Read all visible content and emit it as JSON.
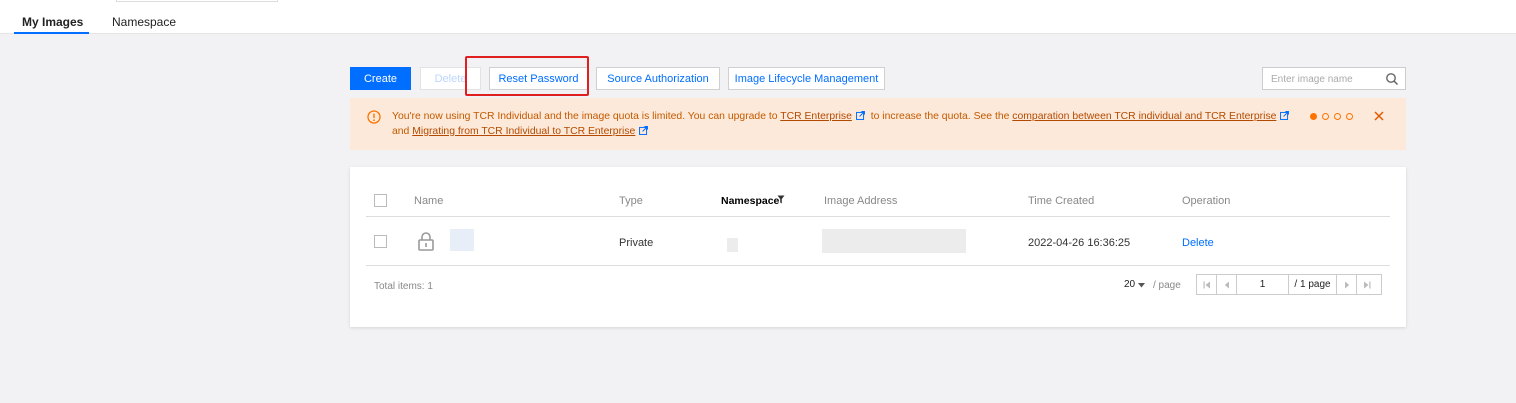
{
  "tabs": [
    {
      "label": "My Images",
      "active": true
    },
    {
      "label": "Namespace",
      "active": false
    }
  ],
  "toolbar": {
    "create": "Create",
    "delete": "Delete",
    "reset_password": "Reset Password",
    "source_authorization": "Source Authorization",
    "image_lifecycle": "Image Lifecycle Management"
  },
  "search": {
    "placeholder": "Enter image name"
  },
  "alert": {
    "text_1": "You're now using TCR Individual and the image quota is limited. You can upgrade to",
    "link_1": "TCR Enterprise",
    "text_2": "to increase the quota. See the",
    "link_2": "comparation between TCR individual and TCR Enterprise",
    "text_3": "and",
    "link_3": "Migrating from TCR Individual to TCR Enterprise",
    "page_count": 4,
    "active_page": 1
  },
  "table": {
    "headers": {
      "name": "Name",
      "type": "Type",
      "namespace": "Namespace",
      "image_address": "Image Address",
      "time_created": "Time Created",
      "operation": "Operation"
    },
    "rows": [
      {
        "type": "Private",
        "time_created": "2022-04-26 16:36:25",
        "operation": "Delete"
      }
    ]
  },
  "footer": {
    "total": "Total items: 1",
    "page_size": "20",
    "per_page": "/ page",
    "current_page": "1",
    "total_pages": "/ 1 page"
  },
  "colors": {
    "primary": "#006eff",
    "warning": "#ff7200",
    "highlight": "#e02020"
  }
}
